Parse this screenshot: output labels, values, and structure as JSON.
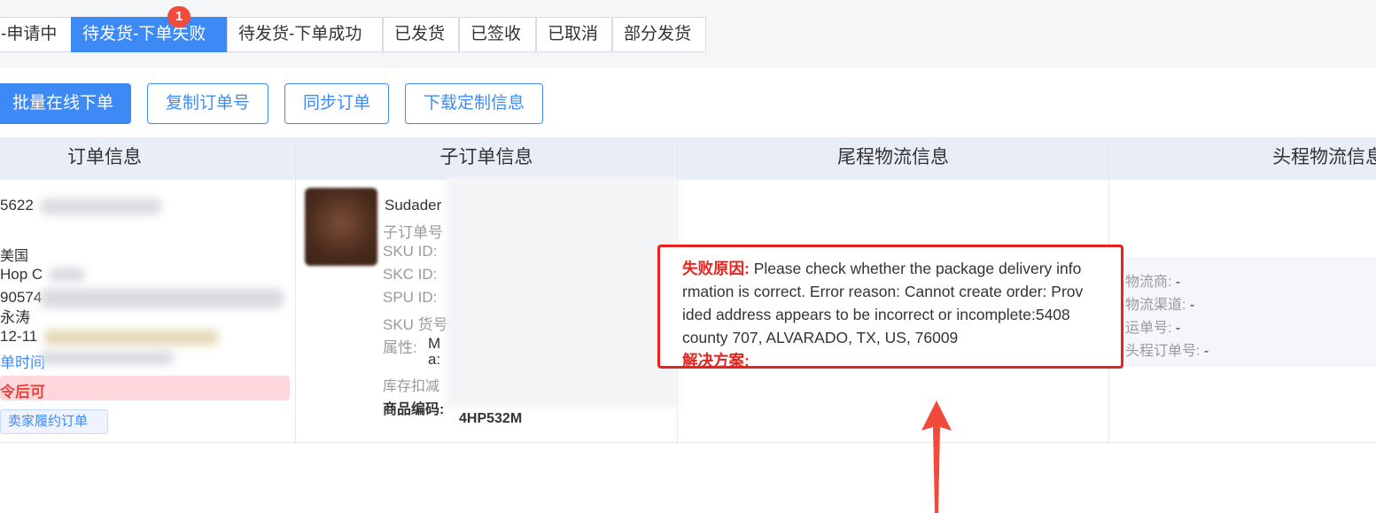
{
  "tabs": [
    {
      "label": "-申请中",
      "active": false
    },
    {
      "label": "待发货-下单失败",
      "active": true,
      "badge": "1"
    },
    {
      "label": "待发货-下单成功",
      "active": false
    },
    {
      "label": "已发货",
      "active": false
    },
    {
      "label": "已签收",
      "active": false
    },
    {
      "label": "已取消",
      "active": false
    },
    {
      "label": "部分发货",
      "active": false
    }
  ],
  "actions": {
    "batch_order": "批量在线下单",
    "copy_order_no": "复制订单号",
    "sync_order": "同步订单",
    "download_custom": "下载定制信息"
  },
  "columns": {
    "order_info": "订单信息",
    "sub_order_info": "子订单信息",
    "last_mile": "尾程物流信息",
    "first_mile": "头程物流信息"
  },
  "order": {
    "order_no_prefix": "5622",
    "country": "美国",
    "addr_line": "Hop C",
    "zip_partial": "90574",
    "name_partial": "永涛",
    "date_partial": "12-11",
    "time_label": "单时间",
    "warning": "令后可",
    "tag": "卖家履约订单"
  },
  "sub_order": {
    "product_prefix": "Sudader",
    "sub_order_no_label": "子订单号",
    "sku_id_label": "SKU ID:",
    "skc_id_label": "SKC ID:",
    "spu_id_label": "SPU ID:",
    "sku_code_label": "SKU 货号",
    "attr_label": "属性:",
    "attr_value_1": "M",
    "attr_value_2": "a:",
    "stock_label": "库存扣减",
    "product_code_label": "商品编码:",
    "product_code_tail": "4HP532M"
  },
  "error": {
    "reason_label": "失败原因:",
    "reason_lines": [
      "Please check whether the package delivery info",
      "rmation is correct. Error reason: Cannot create order: Prov",
      "ided address appears to be incorrect or incomplete:5408",
      "county 707, ALVARADO, TX, US, 76009"
    ],
    "solution_label": "解决方案:"
  },
  "first_mile_info": {
    "carrier": {
      "label": "物流商:",
      "value": "-"
    },
    "channel": {
      "label": "物流渠道:",
      "value": "-"
    },
    "tracking": {
      "label": "运单号:",
      "value": "-"
    },
    "first_order": {
      "label": "头程订单号:",
      "value": "-"
    }
  },
  "colors": {
    "primary": "#3d8af7",
    "error": "#e8231f",
    "header_bg": "#e9edf7"
  }
}
